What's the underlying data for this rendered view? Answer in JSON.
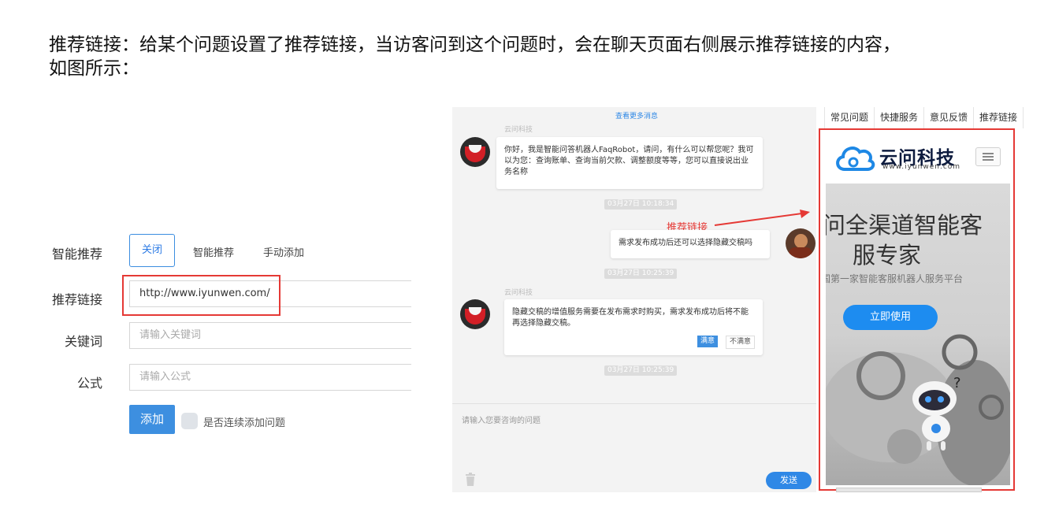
{
  "heading": {
    "line1": "推荐链接：给某个问题设置了推荐链接，当访客问到这个问题时，会在聊天页面右侧展示推荐链接的内容，",
    "line2": "如图所示："
  },
  "form": {
    "smart_recommend_label": "智能推荐",
    "options": [
      "关闭",
      "智能推荐",
      "手动添加"
    ],
    "selected_option": "关闭",
    "recommend_link_label": "推荐链接",
    "recommend_link_value": "http://www.iyunwen.com/",
    "keyword_label": "关键词",
    "keyword_placeholder": "请输入关键词",
    "formula_label": "公式",
    "formula_placeholder": "请输入公式",
    "add_button": "添加",
    "continue_label": "是否连续添加问题"
  },
  "chat": {
    "more_messages": "查看更多消息",
    "bot_name": "云问科技",
    "message1": "你好，我是智能问答机器人FaqRobot，请问，有什么可以帮您呢？我可以为您：查询账单、查询当前欠款、调整额度等等，您可以直接说出业务名称",
    "time1": "03月27日 10:18:34",
    "recommend_label": "推荐链接",
    "user_message": "需求发布成功后还可以选择隐藏交稿吗",
    "time2": "03月27日 10:25:39",
    "bot_name2": "云问科技",
    "message2": "隐藏交稿的增值服务需要在发布需求时购买，需求发布成功后将不能再选择隐藏交稿。",
    "satisfied": "满意",
    "unsatisfied": "不满意",
    "time3": "03月27日 10:25:39",
    "input_placeholder": "请输入您要咨询的问题",
    "send_button": "发送"
  },
  "side_panel": {
    "tabs": [
      "常见问题",
      "快捷服务",
      "意见反馈",
      "推荐链接"
    ],
    "brand_name": "云问科技",
    "brand_url": "www.iyunwen.com",
    "headline_line1": "问全渠道智能客",
    "headline_line2": "服专家",
    "subtitle": "国第一家智能客服机器人服务平台",
    "cta_button": "立即使用"
  },
  "colors": {
    "accent_blue": "#2f88e6",
    "highlight_red": "#e53935"
  }
}
